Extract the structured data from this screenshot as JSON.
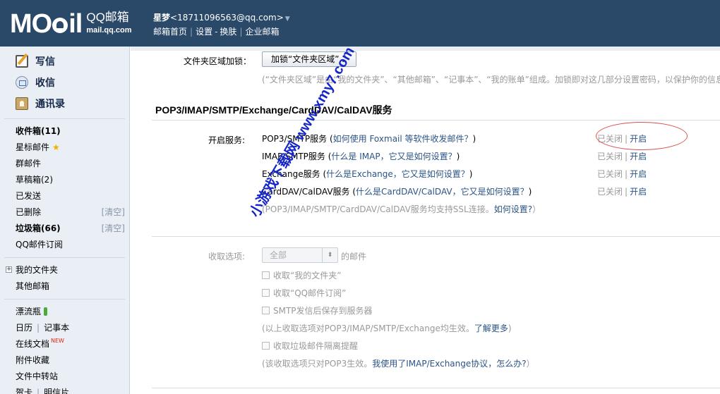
{
  "header": {
    "logo_text": "M",
    "logo_text2": "il",
    "brand_cn": "QQ邮箱",
    "brand_domain": "mail.qq.com",
    "account_name": "星梦",
    "account_email": "<18711096563@qq.com>",
    "links": [
      "邮箱首页",
      "设置",
      "换肤",
      "企业邮箱"
    ]
  },
  "sidebar": {
    "actions": [
      {
        "label": "写信",
        "icon": "compose-icon"
      },
      {
        "label": "收信",
        "icon": "inbox-icon"
      },
      {
        "label": "通讯录",
        "icon": "contacts-icon"
      }
    ],
    "folders": [
      {
        "label": "收件箱(11)",
        "bold": true
      },
      {
        "label": "星标邮件"
      },
      {
        "label": "群邮件"
      },
      {
        "label": "草稿箱(2)"
      },
      {
        "label": "已发送"
      },
      {
        "label": "已删除",
        "right": "[清空]"
      },
      {
        "label": "垃圾箱(66)",
        "bold": true,
        "right": "[清空]"
      },
      {
        "label": "QQ邮件订阅"
      }
    ],
    "my_folders": [
      "我的文件夹",
      "其他邮箱"
    ],
    "apps": {
      "bottle": "漂流瓶",
      "calendar": "日历",
      "notes": "记事本",
      "docs": "在线文档",
      "new_badge": "NEW",
      "attachments": "附件收藏",
      "transfer": "文件中转站",
      "cards": "贺卡",
      "postcards": "明信片"
    }
  },
  "main": {
    "folder_lock_label": "文件夹区域加锁：",
    "folder_lock_button": "加锁“文件夹区域”...",
    "folder_lock_desc": "(“文件夹区域”是由“我的文件夹”、“其他邮箱”、“记事本”、“我的账单”组成。加锁即对这几部分设置密码，以保护你的信息",
    "section_title": "POP3/IMAP/SMTP/Exchange/CardDAV/CalDAV服务",
    "enable_label": "开启服务:",
    "services": [
      {
        "name": "POP3/SMTP服务",
        "help": "如何使用 Foxmail 等软件收发邮件？",
        "status": "已关闭",
        "action": "开启"
      },
      {
        "name": "IMAP/SMTP服务",
        "help": "什么是 IMAP，它又是如何设置？",
        "status": "已关闭",
        "action": "开启"
      },
      {
        "name": "Exchange服务",
        "help": "什么是Exchange，它又是如何设置？",
        "status": "已关闭",
        "action": "开启"
      },
      {
        "name": "CardDAV/CalDAV服务",
        "help": "什么是CardDAV/CalDAV，它又是如何设置？",
        "status": "已关闭",
        "action": "开启"
      }
    ],
    "ssl_note": "(POP3/IMAP/SMTP/CardDAV/CalDAV服务均支持SSL连接。",
    "ssl_link": "如何设置?",
    "ssl_close": "）",
    "receive_label": "收取选项:",
    "receive_select": "全部",
    "receive_suffix": "的邮件",
    "options": [
      "收取“我的文件夹”",
      "收取“QQ邮件订阅”",
      "SMTP发信后保存到服务器"
    ],
    "options_note": "(以上收取选项对POP3/IMAP/SMTP/Exchange均生效。",
    "options_link": "了解更多",
    "options_close": ")",
    "spam_option": "收取垃圾邮件隔离提醒",
    "spam_note": "(该收取选项只对POP3生效。",
    "spam_link": "我使用了IMAP/Exchange协议，怎么办?",
    "spam_close": "）"
  },
  "watermark": "小游戏下载网 www.xmy7.com"
}
